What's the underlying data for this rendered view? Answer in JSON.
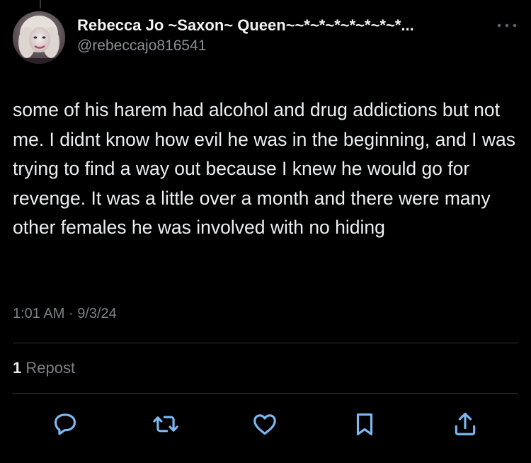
{
  "author": {
    "display_name": "Rebecca Jo ~Saxon~ Queen~~*~*~*~*~*~*~*...",
    "handle": "@rebeccajo816541",
    "avatar": "profile-photo"
  },
  "post": {
    "text": "some of his harem had alcohol and drug addictions but not me. I didnt know how evil he was in the beginning, and I was trying to find a way out because I knew he would go for revenge. It was a little over a month and there were many other females he was involved with no hiding",
    "time": "1:01 AM",
    "separator": "·",
    "date": "9/3/24"
  },
  "stats": {
    "repost_count": "1",
    "repost_label": "Repost"
  },
  "actions": {
    "reply_icon": "speech-bubble-icon",
    "repost_icon": "repost-arrows-icon",
    "like_icon": "heart-icon",
    "bookmark_icon": "bookmark-icon",
    "share_icon": "share-upload-icon"
  },
  "colors": {
    "background": "#000000",
    "text_primary": "#e7e9ea",
    "text_secondary": "#7c8085",
    "icon": "#7db8f0",
    "divider": "#2f3336"
  }
}
